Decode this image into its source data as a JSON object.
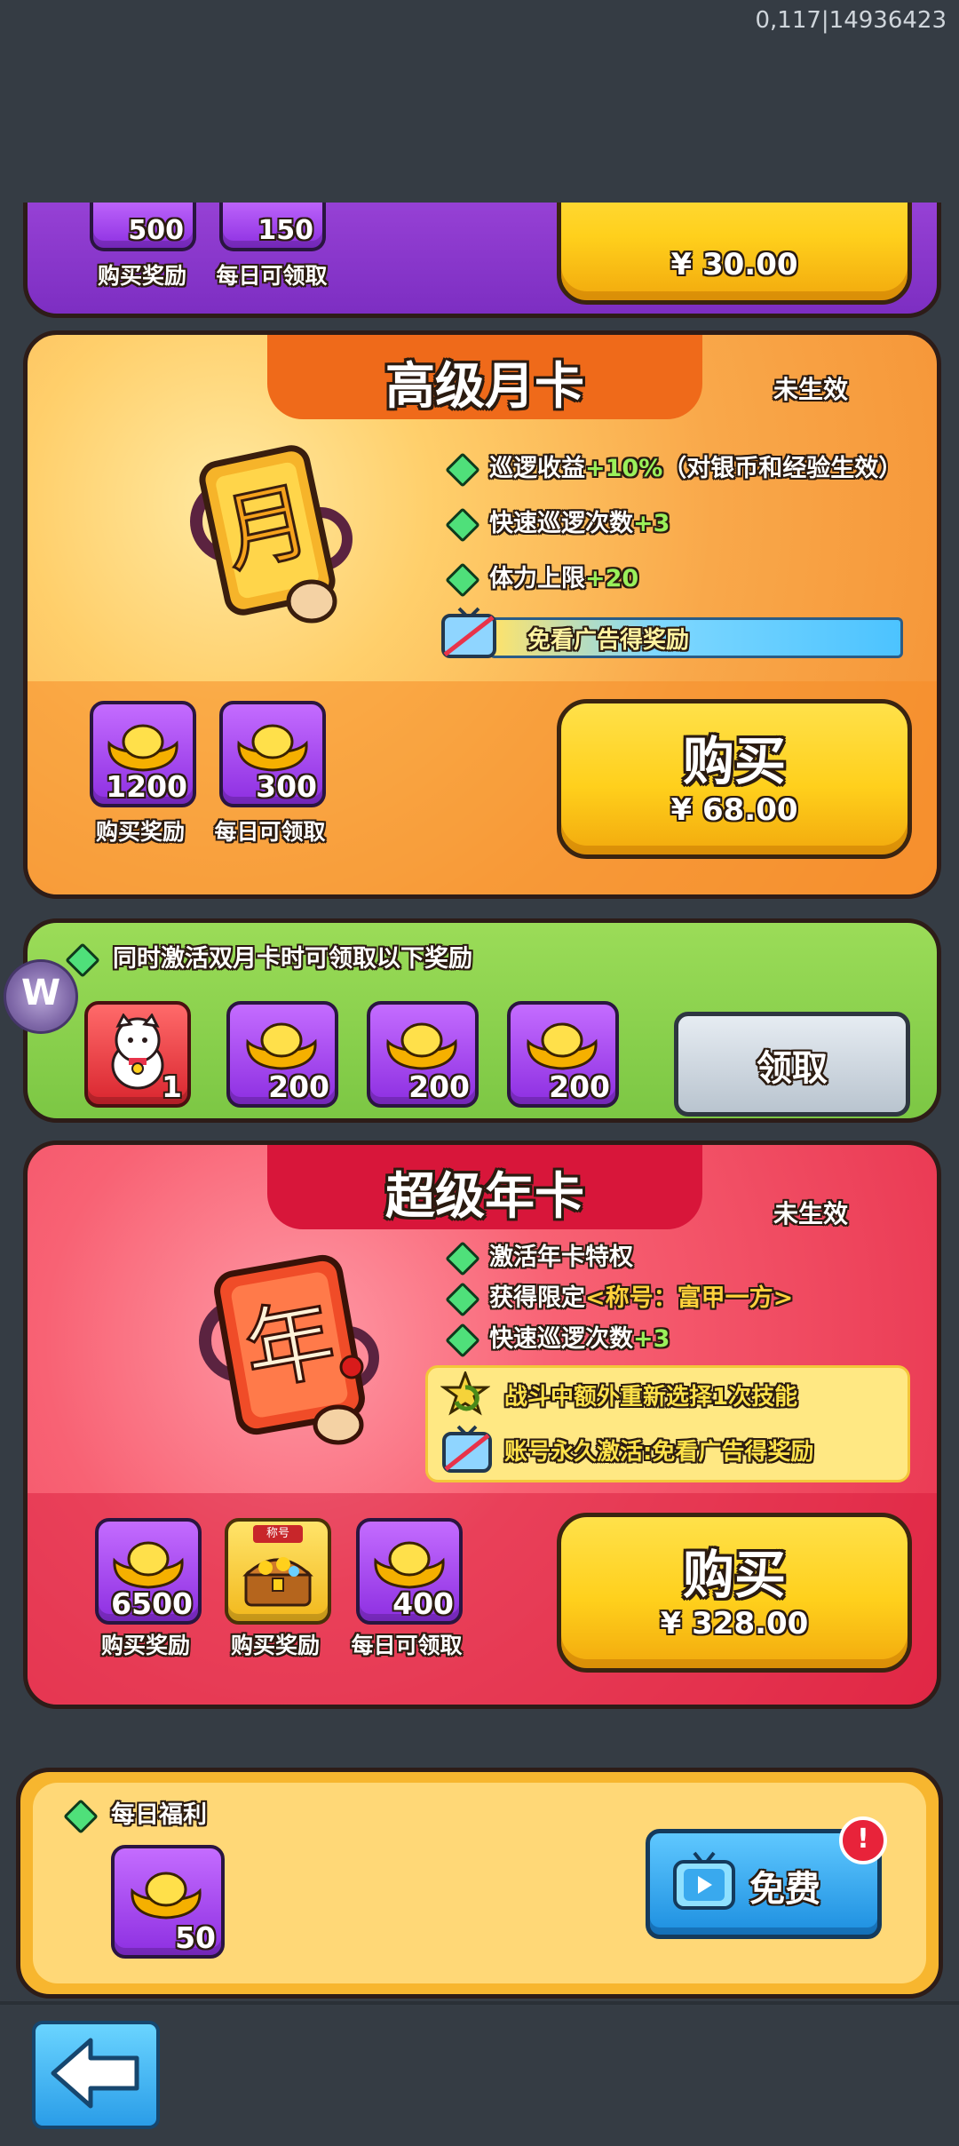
{
  "status": {
    "coords": "0,117|14936423"
  },
  "prev_card": {
    "rewards": [
      {
        "amount": "500",
        "label": "购买奖励"
      },
      {
        "amount": "150",
        "label": "每日可领取"
      }
    ],
    "price": "¥ 30.00"
  },
  "premium_monthly": {
    "title": "高级月卡",
    "status": "未生效",
    "features": [
      {
        "text": "巡逻收益",
        "highlight": "+10%",
        "tail": "（对银币和经验生效）"
      },
      {
        "text": "快速巡逻次数",
        "highlight": "+3",
        "tail": ""
      },
      {
        "text": "体力上限",
        "highlight": "+20",
        "tail": ""
      }
    ],
    "ad_perk": "免看广告得奖励",
    "rewards": [
      {
        "amount": "1200",
        "label": "购买奖励"
      },
      {
        "amount": "300",
        "label": "每日可领取"
      }
    ],
    "buy_label": "购买",
    "price": "¥ 68.00"
  },
  "dual_bonus": {
    "description": "同时激活双月卡时可领取以下奖励",
    "rewards": [
      {
        "amount": "1",
        "kind": "lucky-cat"
      },
      {
        "amount": "200",
        "kind": "gold-ingot"
      },
      {
        "amount": "200",
        "kind": "gold-ingot"
      },
      {
        "amount": "200",
        "kind": "gold-ingot"
      }
    ],
    "claim_label": "领取"
  },
  "super_annual": {
    "title": "超级年卡",
    "status": "未生效",
    "features": [
      {
        "text": "激活年卡特权",
        "highlight": "",
        "tail": ""
      },
      {
        "text": "获得限定",
        "highlight": "<称号：富甲一方>",
        "tail": ""
      },
      {
        "text": "快速巡逻次数",
        "highlight": "+3",
        "tail": ""
      }
    ],
    "perks": [
      "战斗中额外重新选择1次技能",
      "账号永久激活:免看广告得奖励"
    ],
    "rewards": [
      {
        "amount": "6500",
        "label": "购买奖励"
      },
      {
        "amount": "",
        "label": "购买奖励",
        "tag": "称号"
      },
      {
        "amount": "400",
        "label": "每日可领取"
      }
    ],
    "buy_label": "购买",
    "price": "¥ 328.00"
  },
  "daily": {
    "title": "每日福利",
    "reward_amount": "50",
    "free_label": "免费",
    "alert": "!"
  },
  "colors": {
    "accent_yellow": "#ffd01c",
    "premium_orange": "#f7a13a",
    "bonus_green": "#8bd14e",
    "annual_red": "#e8344f",
    "purple_slot": "#a94cf0"
  }
}
